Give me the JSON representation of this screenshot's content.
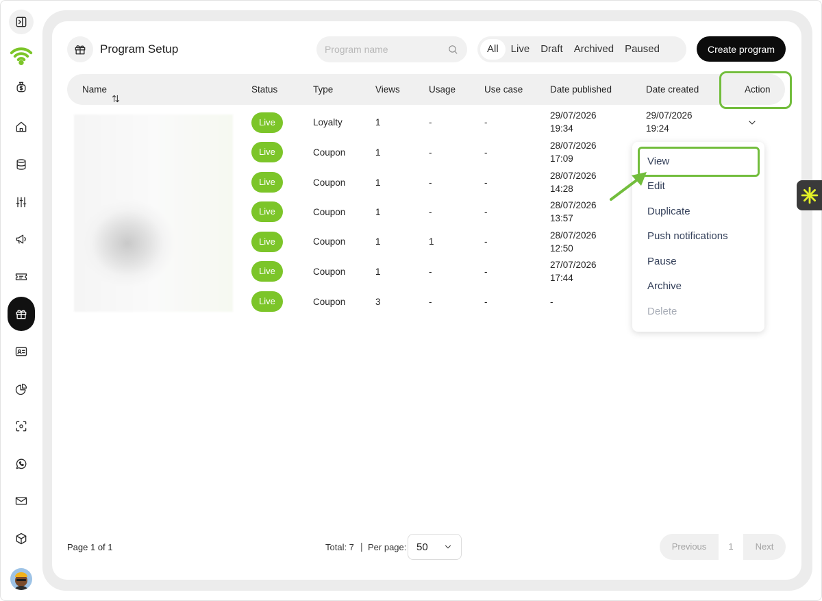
{
  "header": {
    "title": "Program Setup",
    "search_placeholder": "Program name",
    "filters": [
      "All",
      "Live",
      "Draft",
      "Archived",
      "Paused"
    ],
    "active_filter": "All",
    "create_button": "Create program"
  },
  "table": {
    "columns": {
      "name": "Name",
      "status": "Status",
      "type": "Type",
      "views": "Views",
      "usage": "Usage",
      "use_case": "Use case",
      "date_published": "Date published",
      "date_created": "Date created",
      "action": "Action"
    },
    "rows": [
      {
        "status": "Live",
        "type": "Loyalty",
        "views": "1",
        "usage": "-",
        "use_case": "-",
        "pub_date": "29/07/2026",
        "pub_time": "19:34",
        "created_date": "29/07/2026",
        "created_time": "19:24"
      },
      {
        "status": "Live",
        "type": "Coupon",
        "views": "1",
        "usage": "-",
        "use_case": "-",
        "pub_date": "28/07/2026",
        "pub_time": "17:09"
      },
      {
        "status": "Live",
        "type": "Coupon",
        "views": "1",
        "usage": "-",
        "use_case": "-",
        "pub_date": "28/07/2026",
        "pub_time": "14:28"
      },
      {
        "status": "Live",
        "type": "Coupon",
        "views": "1",
        "usage": "-",
        "use_case": "-",
        "pub_date": "28/07/2026",
        "pub_time": "13:57"
      },
      {
        "status": "Live",
        "type": "Coupon",
        "views": "1",
        "usage": "1",
        "use_case": "-",
        "pub_date": "28/07/2026",
        "pub_time": "12:50"
      },
      {
        "status": "Live",
        "type": "Coupon",
        "views": "1",
        "usage": "-",
        "use_case": "-",
        "pub_date": "27/07/2026",
        "pub_time": "17:44"
      },
      {
        "status": "Live",
        "type": "Coupon",
        "views": "3",
        "usage": "-",
        "use_case": "-",
        "pub_date": "-"
      }
    ]
  },
  "action_menu": {
    "items": [
      "View",
      "Edit",
      "Duplicate",
      "Push notifications",
      "Pause",
      "Archive",
      "Delete"
    ],
    "highlighted": "View",
    "disabled": [
      "Delete"
    ]
  },
  "footer": {
    "page_info": "Page 1 of 1",
    "total": "Total: 7",
    "separator": "|",
    "per_page_label": "Per page:",
    "per_page_value": "50",
    "previous": "Previous",
    "current_page": "1",
    "next": "Next"
  },
  "sidebar": {
    "icons": [
      "sidebar-toggle-icon",
      "wifi-logo-icon",
      "money-bag-icon",
      "home-icon",
      "database-icon",
      "sliders-icon",
      "megaphone-icon",
      "ticket-icon",
      "gift-icon",
      "id-card-icon",
      "pie-chart-icon",
      "scan-icon",
      "whatsapp-icon",
      "mail-icon",
      "cube-icon",
      "avatar"
    ],
    "active": "gift-icon"
  },
  "colors": {
    "brand_green": "#7cc529",
    "highlight_green": "#72bd3c",
    "primary_button": "#0c0c0c",
    "widget_yellow": "#e4f227"
  }
}
